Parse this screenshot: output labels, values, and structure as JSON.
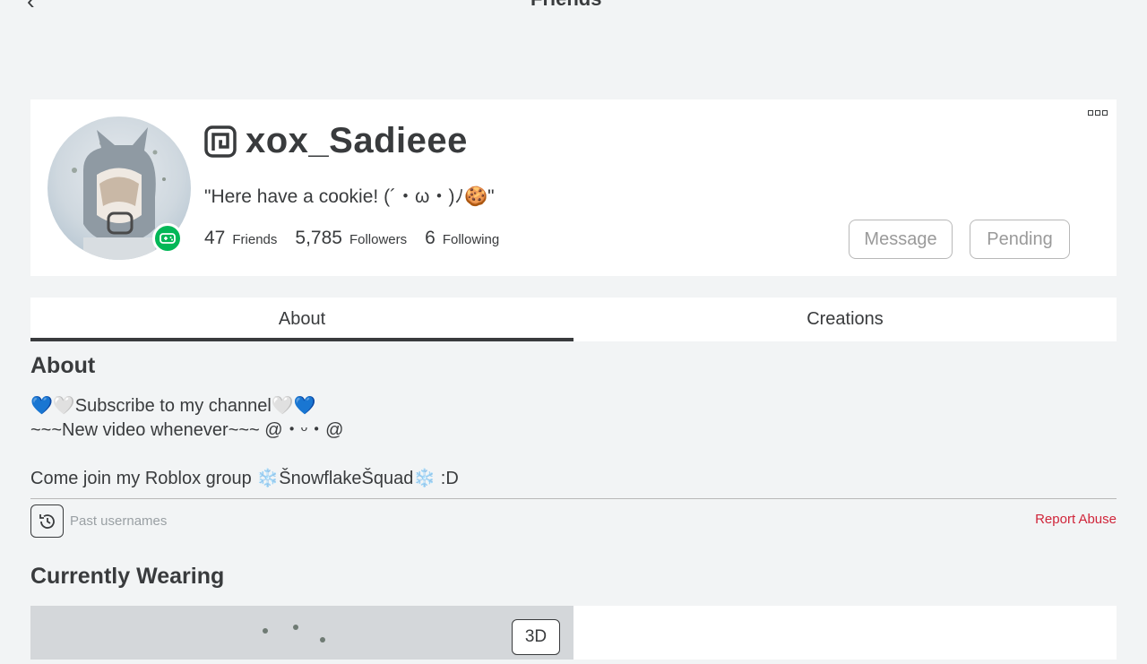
{
  "topbar": {
    "back_glyph": "‹",
    "title": "Friends"
  },
  "profile": {
    "username": "xox_Sadieee",
    "status": "\"Here have a cookie! (´・ω・)ﾉ🍪\"",
    "stats": {
      "friends_count": "47",
      "friends_label": "Friends",
      "followers_count": "5,785",
      "followers_label": "Followers",
      "following_count": "6",
      "following_label": "Following"
    },
    "buttons": {
      "message": "Message",
      "pending": "Pending"
    },
    "presence": "in-game"
  },
  "tabs": {
    "about": "About",
    "creations": "Creations",
    "active": "About"
  },
  "about": {
    "heading": "About",
    "lines": [
      "💙🤍Subscribe to my channel🤍💙",
      "~~~New video whenever~~~ @・ᵕ・@",
      "",
      "Come join my Roblox group ❄️ŠnowflakeŠquad❄️ :D"
    ],
    "past_usernames_label": "Past usernames",
    "report_abuse": "Report Abuse"
  },
  "wearing": {
    "heading": "Currently Wearing",
    "btn_3d": "3D"
  },
  "colors": {
    "presence_green": "#02b757",
    "report_red": "#d0253a",
    "text": "#393b3d"
  },
  "icons": [
    "back-arrow-icon",
    "more-options-icon",
    "premium-icon",
    "game-controller-icon",
    "history-icon"
  ]
}
